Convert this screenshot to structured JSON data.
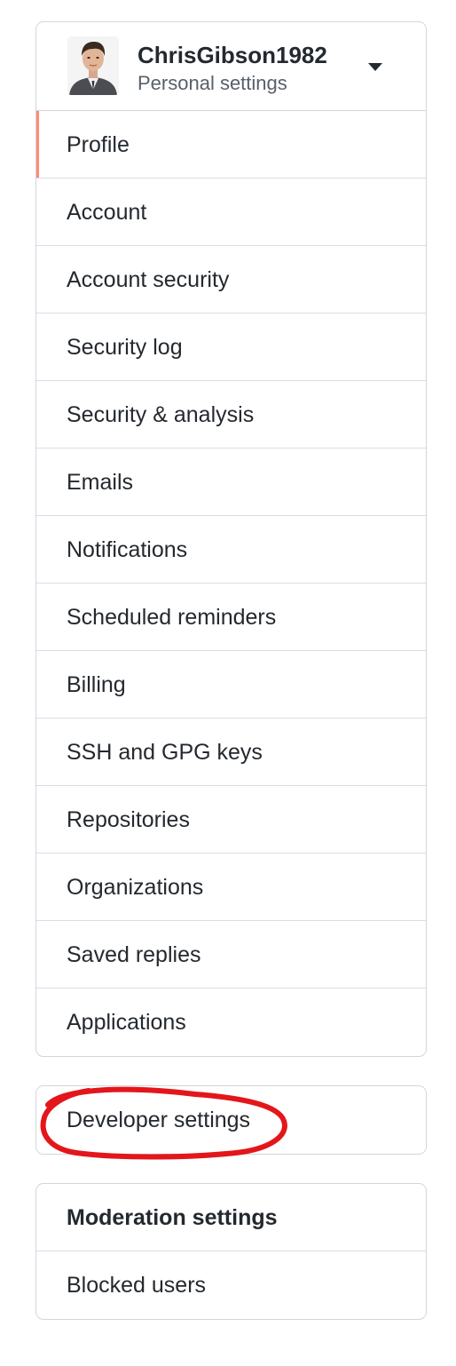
{
  "header": {
    "username": "ChrisGibson1982",
    "subtitle": "Personal settings"
  },
  "nav": {
    "items": [
      {
        "label": "Profile",
        "active": true
      },
      {
        "label": "Account"
      },
      {
        "label": "Account security"
      },
      {
        "label": "Security log"
      },
      {
        "label": "Security & analysis"
      },
      {
        "label": "Emails"
      },
      {
        "label": "Notifications"
      },
      {
        "label": "Scheduled reminders"
      },
      {
        "label": "Billing"
      },
      {
        "label": "SSH and GPG keys"
      },
      {
        "label": "Repositories"
      },
      {
        "label": "Organizations"
      },
      {
        "label": "Saved replies"
      },
      {
        "label": "Applications"
      }
    ]
  },
  "developer": {
    "label": "Developer settings"
  },
  "moderation": {
    "heading": "Moderation settings",
    "items": [
      {
        "label": "Blocked users"
      }
    ]
  },
  "colors": {
    "active_indicator": "#fd8c73",
    "annotation": "#e3161b",
    "border": "#d0d7de"
  },
  "icons": {
    "avatar": "user-avatar-photo",
    "dropdown": "caret-down-icon"
  }
}
